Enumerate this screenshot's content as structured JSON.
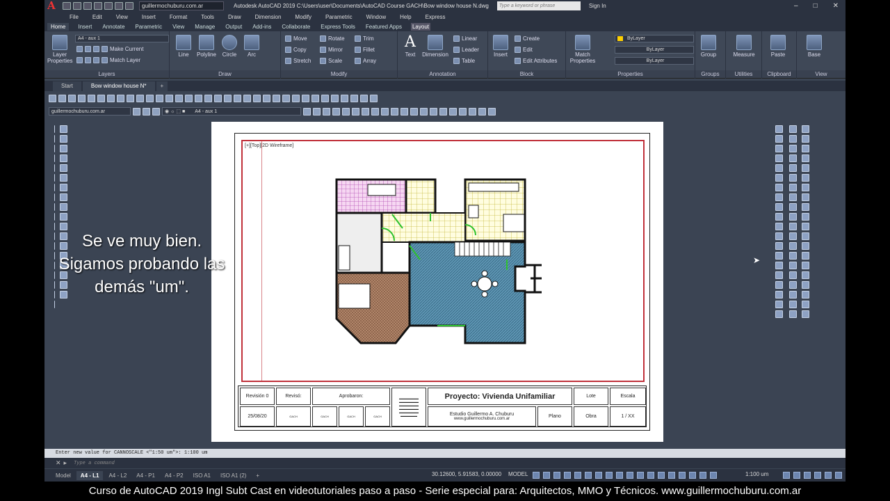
{
  "titlebar": {
    "logo": "A",
    "workspace": "guillermochuburu.com.ar",
    "title": "Autodesk AutoCAD 2019   C:\\Users\\user\\Documents\\AutoCAD Course GACH\\Bow window house N.dwg",
    "search_placeholder": "Type a keyword or phrase",
    "signin": "Sign In",
    "minimize": "–",
    "maximize": "□",
    "close": "✕"
  },
  "menubar": [
    "File",
    "Edit",
    "View",
    "Insert",
    "Format",
    "Tools",
    "Draw",
    "Dimension",
    "Modify",
    "Parametric",
    "Window",
    "Help",
    "Express"
  ],
  "ribbon_tabs": [
    "Home",
    "Insert",
    "Annotate",
    "Parametric",
    "View",
    "Manage",
    "Output",
    "Add-ins",
    "Collaborate",
    "Express Tools",
    "Featured Apps",
    "Layout"
  ],
  "ribbon": {
    "layers": {
      "big": "Layer Properties",
      "dropdown": "A4 - aux 1",
      "make_current": "Make Current",
      "match_layer": "Match Layer",
      "title": "Layers"
    },
    "draw": {
      "line": "Line",
      "polyline": "Polyline",
      "circle": "Circle",
      "arc": "Arc",
      "title": "Draw"
    },
    "modify": {
      "move": "Move",
      "rotate": "Rotate",
      "trim": "Trim",
      "copy": "Copy",
      "mirror": "Mirror",
      "fillet": "Fillet",
      "stretch": "Stretch",
      "scale": "Scale",
      "array": "Array",
      "title": "Modify"
    },
    "annotation": {
      "text": "Text",
      "dimension": "Dimension",
      "linear": "Linear",
      "leader": "Leader",
      "table": "Table",
      "title": "Annotation"
    },
    "block": {
      "insert": "Insert",
      "create": "Create",
      "edit": "Edit",
      "edit_attributes": "Edit Attributes",
      "title": "Block"
    },
    "properties": {
      "match": "Match Properties",
      "color": "ByLayer",
      "linetype": "ByLayer",
      "lineweight": "ByLayer",
      "title": "Properties"
    },
    "groups": {
      "group": "Group",
      "title": "Groups"
    },
    "utilities": {
      "measure": "Measure",
      "title": "Utilities"
    },
    "clipboard": {
      "paste": "Paste",
      "title": "Clipboard"
    },
    "view": {
      "base": "Base",
      "title": "View"
    }
  },
  "file_tabs": [
    "Start",
    "Bow window house N*"
  ],
  "toolbar2": {
    "workspace": "guillermochuburu.com.ar",
    "layer": "A4 - aux 1"
  },
  "viewport_label": "[+][Top][2D Wireframe]",
  "titleblock": {
    "rev": "Revisión 0",
    "reviso": "Revisó:",
    "aprobaron": "Aprobaron:",
    "project": "Proyecto: Vivienda Unifamiliar",
    "lote": "Lote",
    "escala": "Escala",
    "date": "25/08/20",
    "studio": "Estudio Guillermo A. Chuburu",
    "web": "www.guillermochuburu.com.ar",
    "plano": "Plano",
    "obra": "Obra",
    "scale_val": "1 / XX",
    "gach": "GACH"
  },
  "overlay_text": "Se ve muy bien. Sigamos probando las demás \"um\".",
  "command": {
    "history": "Enter new value for CANNOSCALE <\"1:50 um\">: 1:100 um",
    "placeholder": "Type a command"
  },
  "layout_tabs": [
    "Model",
    "A4 - L1",
    "A4 - L2",
    "A4 - P1",
    "A4 - P2",
    "ISO A1",
    "ISO A1 (2)"
  ],
  "active_layout": "A4 - L1",
  "status": {
    "coords": "30.12600, 5.91583, 0.00000",
    "model": "MODEL",
    "scale": "1:100 um"
  },
  "footer": "Curso de AutoCAD 2019 Ingl Subt Cast en videotutoriales paso a paso - Serie especial para: Arquitectos, MMO y Técnicos.  www.guillermochuburu.com.ar"
}
